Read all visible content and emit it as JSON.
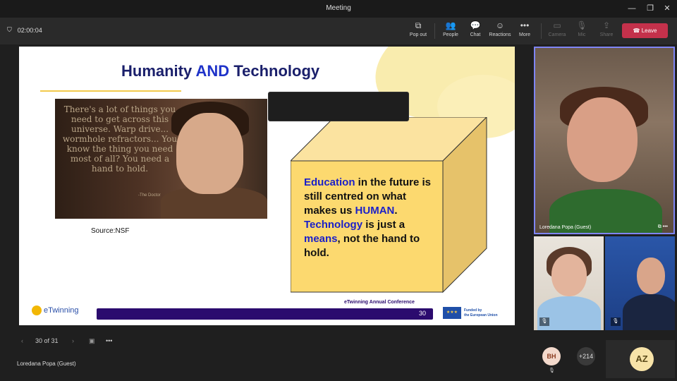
{
  "window": {
    "title": "Meeting",
    "minimize": "—",
    "maximize": "❐",
    "close": "✕"
  },
  "toolbar": {
    "timer": "02:00:04",
    "shield_icon": "shield-icon",
    "buttons": [
      {
        "label": "Pop out",
        "icon": "⧉"
      },
      {
        "label": "People",
        "icon": "👥"
      },
      {
        "label": "Chat",
        "icon": "💬"
      },
      {
        "label": "Reactions",
        "icon": "☺"
      },
      {
        "label": "More",
        "icon": "•••"
      },
      {
        "label": "Camera",
        "icon": "▭"
      },
      {
        "label": "Mic",
        "icon": "🎙"
      },
      {
        "label": "Share",
        "icon": "⇪"
      }
    ],
    "leave_label": "Leave"
  },
  "slide": {
    "title_part1": "Humanity ",
    "title_and": "AND",
    "title_part2": " Technology",
    "quote": "There's a lot of things you need to get across this universe. Warp drive... wormhole refractors... You know the thing you need most of all? You need a hand to hold.",
    "quote_attrib": "-The Doctor",
    "source": "Source:NSF",
    "cube": {
      "w1": "Education",
      "t1": " in the future is still centred on what makes us ",
      "w2": "HUMAN",
      "t2": ". ",
      "w3": "Technology",
      "t3": " is just a ",
      "w4": "means",
      "t4": ", not the hand to hold."
    },
    "footer_logo": "eTwinning",
    "footer_conference": "eTwinning Annual Conference",
    "footer_page": "30",
    "eu_line1": "Funded by",
    "eu_line2": "the European Union"
  },
  "slidenav": {
    "position": "30 of 31",
    "prev": "‹",
    "next": "›",
    "grid_icon": "▣",
    "more": "•••"
  },
  "presenter_name": "Loredana Popa (Guest)",
  "participants": {
    "main_label": "Loredana Popa (Guest)",
    "main_icons": "⧉ •••",
    "avatar_bh": "BH",
    "overflow": "+214",
    "avatar_az": "AZ",
    "mic_muted": "🎙"
  }
}
